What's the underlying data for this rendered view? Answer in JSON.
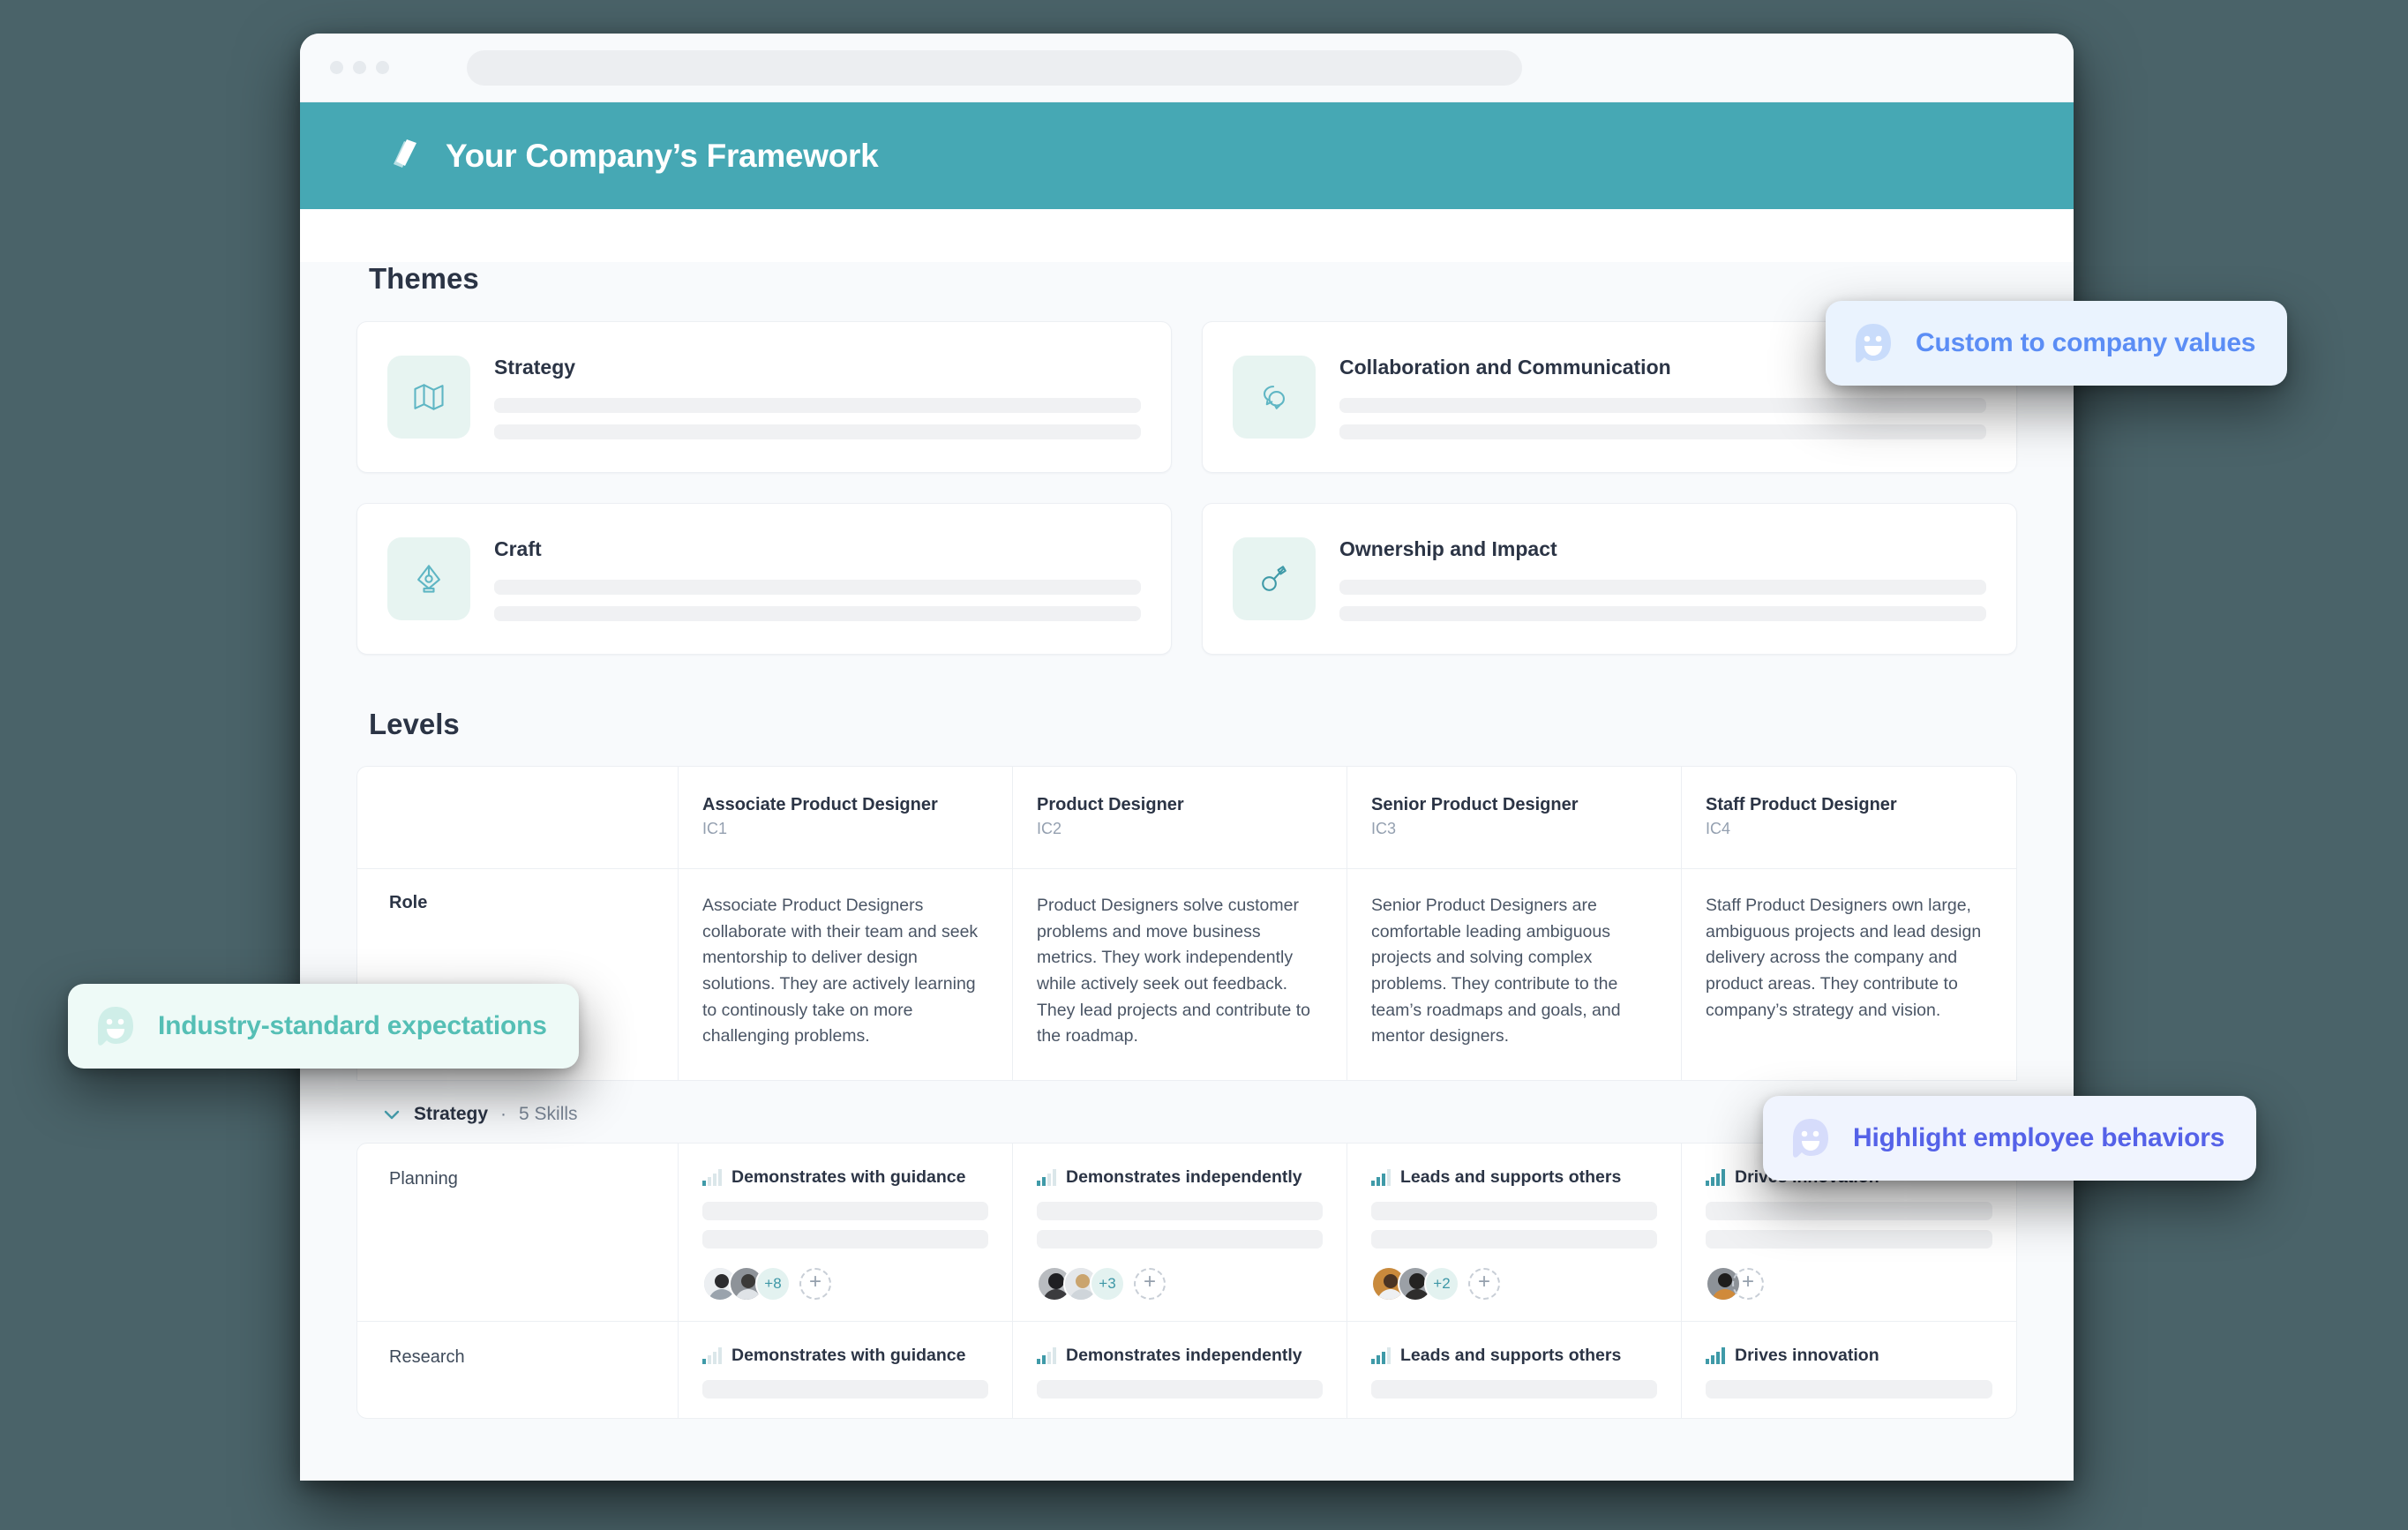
{
  "window": {
    "traffic_dots": 3,
    "url_value": ""
  },
  "header": {
    "title": "Your Company’s Framework",
    "logo_icon": "leaf-pages-icon",
    "bg_color": "#46a8b4"
  },
  "themes": {
    "section_title": "Themes",
    "cards": [
      {
        "name": "Strategy",
        "icon": "map-icon"
      },
      {
        "name": "Collaboration and Communication",
        "icon": "chat-bubbles-icon"
      },
      {
        "name": "Craft",
        "icon": "pen-nib-icon"
      },
      {
        "name": "Ownership and Impact",
        "icon": "key-icon"
      }
    ]
  },
  "levels": {
    "section_title": "Levels",
    "columns": [
      {
        "title": "Associate Product Designer",
        "code": "IC1"
      },
      {
        "title": "Product Designer",
        "code": "IC2"
      },
      {
        "title": "Senior Product Designer",
        "code": "IC3"
      },
      {
        "title": "Staff Product Designer",
        "code": "IC4"
      }
    ],
    "role_row_label": "Role",
    "role_descriptions": [
      "Associate Product Designers collaborate with their team and seek mentorship to deliver design solutions. They are actively learning to continously take on more challenging problems.",
      "Product Designers solve customer problems and move business metrics. They work independently while actively seek out feedback. They lead projects and contribute to the roadmap.",
      "Senior Product Designers are comfortable leading ambiguous projects and solving complex problems. They contribute to the team’s roadmaps and goals, and mentor designers.",
      "Staff Product Designers own large, ambiguous projects and lead design delivery across the company and product areas. They contribute to company’s strategy and vision."
    ]
  },
  "skill_group": {
    "caret_icon": "chevron-down-icon",
    "title": "Strategy",
    "separator": "·",
    "count_label": "5 Skills",
    "rows": [
      {
        "name": "Planning",
        "cells": [
          {
            "level_label": "Demonstrates with guidance",
            "bars": 1,
            "avatars": 2,
            "more_count": "+8",
            "add_label": "+"
          },
          {
            "level_label": "Demonstrates independently",
            "bars": 2,
            "avatars": 2,
            "more_count": "+3",
            "add_label": "+"
          },
          {
            "level_label": "Leads and supports others",
            "bars": 3,
            "avatars": 2,
            "more_count": "+2",
            "add_label": "+"
          },
          {
            "level_label": "Drives innovation",
            "bars": 4,
            "avatars": 1,
            "more_count": "",
            "add_label": "+"
          }
        ]
      },
      {
        "name": "Research",
        "cells": [
          {
            "level_label": "Demonstrates with guidance",
            "bars": 1,
            "avatars": 0,
            "more_count": "",
            "add_label": ""
          },
          {
            "level_label": "Demonstrates independently",
            "bars": 2,
            "avatars": 0,
            "more_count": "",
            "add_label": ""
          },
          {
            "level_label": "Leads and supports others",
            "bars": 3,
            "avatars": 0,
            "more_count": "",
            "add_label": ""
          },
          {
            "level_label": "Drives innovation",
            "bars": 4,
            "avatars": 0,
            "more_count": "",
            "add_label": ""
          }
        ]
      }
    ]
  },
  "callouts": [
    {
      "id": "values",
      "text": "Custom to company values",
      "icon": "ghost-smile-icon",
      "bg": "#eaf3fe",
      "color": "#5b8df5"
    },
    {
      "id": "industry",
      "text": "Industry-standard expectations",
      "icon": "ghost-smile-icon",
      "bg": "#eefaf7",
      "color": "#55bfb5"
    },
    {
      "id": "behaviors",
      "text": "Highlight employee behaviors",
      "icon": "ghost-smile-icon",
      "bg": "#f0f4fe",
      "color": "#5562e8"
    }
  ]
}
